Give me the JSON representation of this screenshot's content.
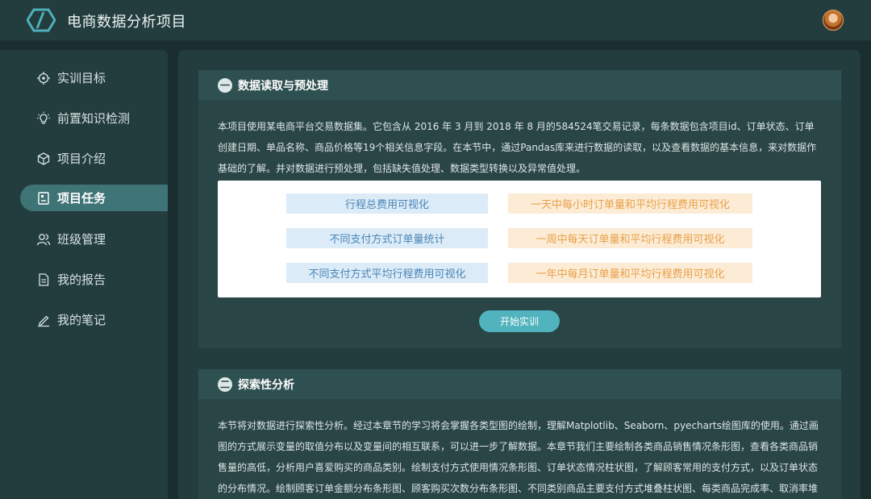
{
  "app": {
    "title": "电商数据分析项目"
  },
  "sidebar": {
    "items": [
      {
        "label": "实训目标",
        "icon": "target-icon",
        "active": false
      },
      {
        "label": "前置知识检测",
        "icon": "lightbulb-icon",
        "active": false
      },
      {
        "label": "项目介绍",
        "icon": "cube-icon",
        "active": false
      },
      {
        "label": "项目任务",
        "icon": "task-doc-icon",
        "active": true
      },
      {
        "label": "班级管理",
        "icon": "users-icon",
        "active": false
      },
      {
        "label": "我的报告",
        "icon": "report-icon",
        "active": false
      },
      {
        "label": "我的笔记",
        "icon": "pen-icon",
        "active": false
      }
    ]
  },
  "sections": [
    {
      "number": "一",
      "title": "数据读取与预处理",
      "description": "本项目使用某电商平台交易数据集。它包含从 2016 年 3 月到 2018 年 8 月的584524笔交易记录，每条数据包含项目id、订单状态、订单创建日期、单品名称、商品价格等19个相关信息字段。在本节中，通过Pandas库来进行数据的读取，以及查看数据的基本信息，来对数据作基础的了解。并对数据进行预处理，包括缺失值处理、数据类型转换以及异常值处理。",
      "tasks": {
        "blue": [
          "行程总费用可视化",
          "不同支付方式订单量统计",
          "不同支付方式平均行程费用可视化"
        ],
        "orange": [
          "一天中每小时订单量和平均行程费用可视化",
          "一周中每天订单量和平均行程费用可视化",
          "一年中每月订单量和平均行程费用可视化"
        ]
      },
      "start_label": "开始实训"
    },
    {
      "number": "二",
      "title": "探索性分析",
      "description": "本节将对数据进行探索性分析。经过本章节的学习将会掌握各类型图的绘制，理解Matplotlib、Seaborn、pyecharts绘图库的使用。通过画图的方式展示变量的取值分布以及变量间的相互联系，可以进一步了解数据。本章节我们主要绘制各类商品销售情况条形图，查看各类商品销售量的高低，分析用户喜爱购买的商品类别。绘制支付方式使用情况条形图、订单状态情况柱状图，了解顾客常用的支付方式，以及订单状态的分布情况。绘制顾客订单金额分布条形图、顾客购买次数分布条形图、不同类别商品主要支付方式堆叠柱状图、每类商品完成率、取消率堆叠柱状图，以及绘"
    }
  ],
  "colors": {
    "background": "#1b2e2f",
    "panel": "#233d3e",
    "active_nav": "#3f7477",
    "start_button": "#50b3bd",
    "task_blue_bg": "#dcebf8",
    "task_blue_text": "#4a86b5",
    "task_orange_bg": "#fcecd6",
    "task_orange_text": "#e8a048"
  }
}
